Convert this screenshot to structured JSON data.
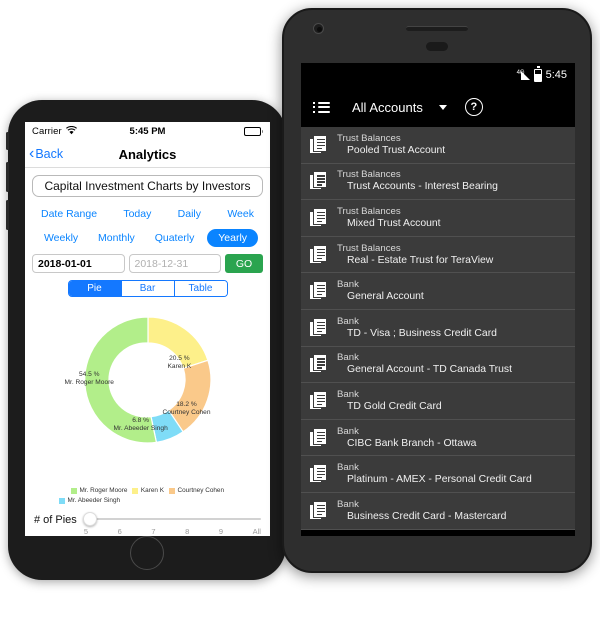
{
  "iphone": {
    "status": {
      "carrier": "Carrier",
      "time": "5:45 PM",
      "wifi_icon": "wifi-icon"
    },
    "nav": {
      "back_label": "Back",
      "title": "Analytics"
    },
    "header_title": "Capital Investment Charts by Investors",
    "range_row_1": [
      {
        "label": "Date Range",
        "active": false
      },
      {
        "label": "Today",
        "active": false
      },
      {
        "label": "Daily",
        "active": false
      },
      {
        "label": "Week",
        "active": false
      }
    ],
    "range_row_2": [
      {
        "label": "Weekly",
        "active": false
      },
      {
        "label": "Monthly",
        "active": false
      },
      {
        "label": "Quaterly",
        "active": false
      },
      {
        "label": "Yearly",
        "active": true
      }
    ],
    "date_from": {
      "value": "2018-01-01",
      "placeholder": "2018-01-01"
    },
    "date_to": {
      "value": "",
      "placeholder": "2018-12-31"
    },
    "go_label": "GO",
    "view_tabs": [
      {
        "label": "Pie",
        "active": true
      },
      {
        "label": "Bar",
        "active": false
      },
      {
        "label": "Table",
        "active": false
      }
    ],
    "slider": {
      "label": "# of Pies",
      "ticks": [
        "5",
        "6",
        "7",
        "8",
        "9",
        "All"
      ],
      "value": "5"
    }
  },
  "chart_data": {
    "type": "pie",
    "title": "Capital Investment Charts by Investors",
    "donut": true,
    "legend_position": "bottom",
    "categories": [
      "Mr. Roger  Moore",
      "Karen  K",
      "Courtney  Cohen",
      "Mr. Abeeder  Singh"
    ],
    "values": [
      54.5,
      20.5,
      18.2,
      6.8
    ],
    "value_suffix": "%",
    "colors": [
      "#b2ee8a",
      "#fdf08a",
      "#fac98a",
      "#7fdcf7"
    ],
    "labels": [
      {
        "pct": "54.5 %",
        "name": "Mr. Roger  Moore"
      },
      {
        "pct": "20.5 %",
        "name": "Karen  K"
      },
      {
        "pct": "18.2 %",
        "name": "Courtney  Cohen"
      },
      {
        "pct": "6.8 %",
        "name": "Mr. Abeeder  Singh"
      }
    ]
  },
  "android": {
    "status": {
      "time": "5:45",
      "network": "4G",
      "signal_icon": "signal-icon",
      "battery_icon": "battery-icon"
    },
    "toolbar": {
      "menu_icon": "hamburger-menu-icon",
      "spinner_label": "All Accounts",
      "caret_icon": "chevron-down-icon",
      "help_icon": "help-circle-icon",
      "help_glyph": "?"
    },
    "rows": [
      {
        "title": "Trust Balances",
        "sub": "Pooled Trust Account"
      },
      {
        "title": "Trust Balances",
        "sub": "Trust Accounts - Interest Bearing"
      },
      {
        "title": "Trust Balances",
        "sub": "Mixed Trust Account"
      },
      {
        "title": "Trust Balances",
        "sub": "Real - Estate Trust for TeraView"
      },
      {
        "title": "Bank",
        "sub": "General Account"
      },
      {
        "title": "Bank",
        "sub": "TD - Visa ; Business Credit Card"
      },
      {
        "title": "Bank",
        "sub": "General Account - TD Canada Trust"
      },
      {
        "title": "Bank",
        "sub": "TD Gold Credit Card"
      },
      {
        "title": "Bank",
        "sub": "CIBC Bank Branch - Ottawa"
      },
      {
        "title": "Bank",
        "sub": "Platinum - AMEX - Personal Credit Card"
      },
      {
        "title": "Bank",
        "sub": "Business Credit Card - Mastercard"
      }
    ],
    "navbar": {
      "back_icon": "nav-back-icon",
      "home_icon": "nav-home-icon",
      "recent_icon": "nav-recents-icon"
    }
  },
  "colors": {
    "ios_blue": "#1478ff",
    "go_green": "#2aa44f",
    "android_dark": "#3b3b3b"
  }
}
